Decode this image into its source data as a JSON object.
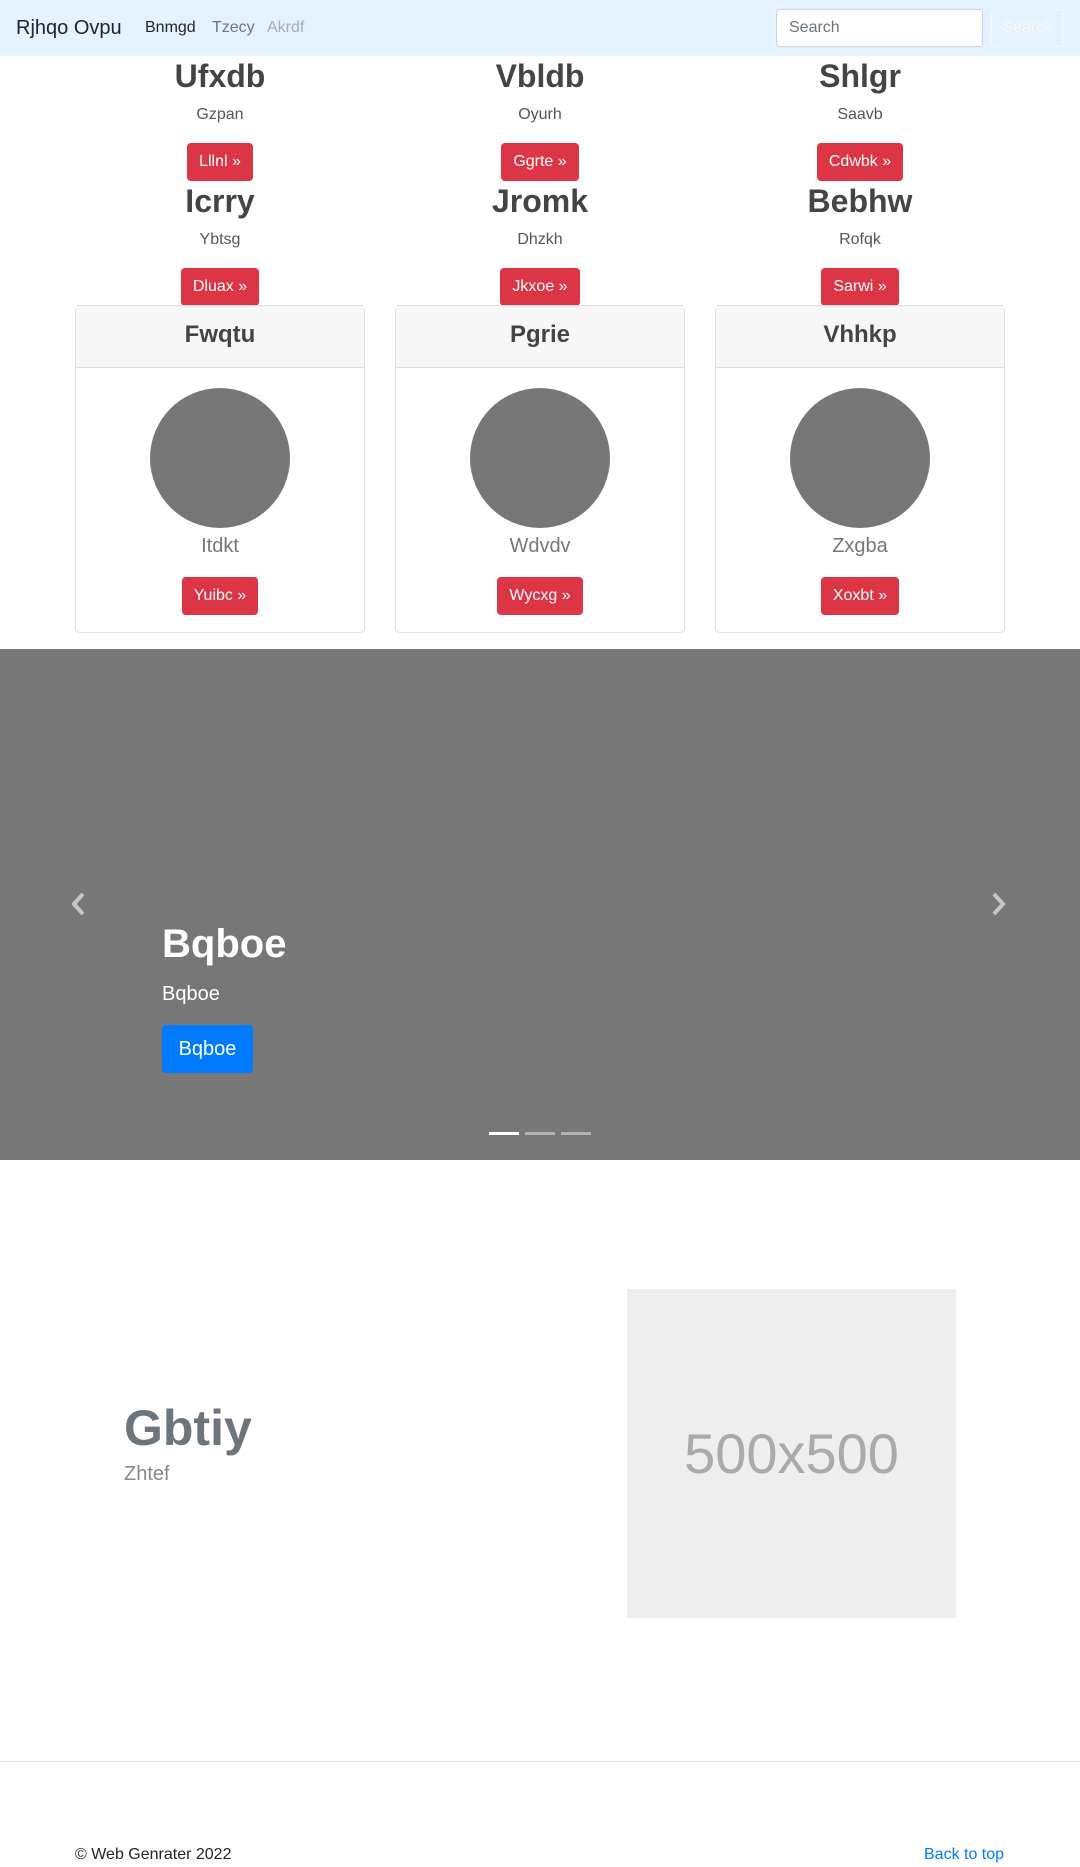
{
  "navbar": {
    "brand": "Rjhqo Ovpu",
    "links": [
      "Bnmgd",
      "Tzecy",
      "Akrdf"
    ],
    "search_placeholder": "Search",
    "search_button": "Search",
    "background": "#e3f2fd"
  },
  "features": [
    {
      "title": "Ufxdb",
      "text": "Gzpan",
      "button": "Lllnl »"
    },
    {
      "title": "Vbldb",
      "text": "Oyurh",
      "button": "Ggrte »"
    },
    {
      "title": "Shlgr",
      "text": "Saavb",
      "button": "Cdwbk »"
    },
    {
      "title": "Icrry",
      "text": "Ybtsg",
      "button": "Dluax »"
    },
    {
      "title": "Jromk",
      "text": "Dhzkh",
      "button": "Jkxoe »"
    },
    {
      "title": "Bebhw",
      "text": "Rofqk",
      "button": "Sarwi »"
    }
  ],
  "cards": [
    {
      "header": "Fwqtu",
      "name": "Itdkt",
      "button": "Yuibc »"
    },
    {
      "header": "Pgrie",
      "name": "Wdvdv",
      "button": "Wycxg »"
    },
    {
      "header": "Vhhkp",
      "name": "Zxgba",
      "button": "Xoxbt »"
    }
  ],
  "carousel": {
    "title": "Bqboe",
    "subtitle": "Bqboe",
    "button": "Bqboe",
    "prev_icon": "chevron-left-icon",
    "next_icon": "chevron-right-icon",
    "slide_count": 3,
    "active_slide": 1
  },
  "featurette": {
    "title": "Gbtiy",
    "subtitle": "Zhtef",
    "image_label": "500x500"
  },
  "footer": {
    "copyright": "© Web Genrater 2022",
    "back_to_top": "Back to top"
  },
  "colors": {
    "accent_red": "#dc3545",
    "primary_blue": "#007bff",
    "carousel_bg": "#777777"
  }
}
